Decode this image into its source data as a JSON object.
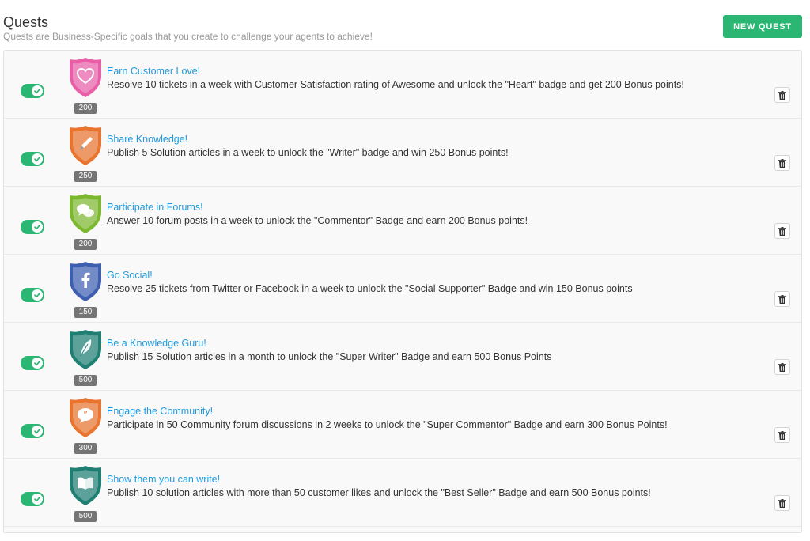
{
  "header": {
    "title": "Quests",
    "subtitle": "Quests are Business-Specific goals that you create to challenge your agents to achieve!",
    "new_quest_label": "NEW QUEST"
  },
  "colors": {
    "accent_green": "#2bb673",
    "link_blue": "#1e9be0"
  },
  "quests": [
    {
      "title": "Earn Customer Love!",
      "description": "Resolve 10 tickets in a week with Customer Satisfaction rating of Awesome and unlock the \"Heart\" badge and get 200 Bonus points!",
      "points": "200",
      "badge_icon": "heart-icon",
      "badge_color": "#e85fa8",
      "enabled": true
    },
    {
      "title": "Share Knowledge!",
      "description": "Publish 5 Solution articles in a week to unlock the \"Writer\" badge and win 250 Bonus points!",
      "points": "250",
      "badge_icon": "pen-icon",
      "badge_color": "#e8742f",
      "enabled": true
    },
    {
      "title": "Participate in Forums!",
      "description": "Answer 10 forum posts in a week to unlock the \"Commentor\" Badge and earn 200 Bonus points!",
      "points": "200",
      "badge_icon": "chat-bubbles-icon",
      "badge_color": "#7cb82f",
      "enabled": true
    },
    {
      "title": "Go Social!",
      "description": "Resolve 25 tickets from Twitter or Facebook in a week to unlock the \"Social Supporter\" Badge and win 150 Bonus points",
      "points": "150",
      "badge_icon": "facebook-icon",
      "badge_color": "#3e5fb0",
      "enabled": true
    },
    {
      "title": "Be a Knowledge Guru!",
      "description": "Publish 15 Solution articles in a month to unlock the \"Super Writer\" Badge and earn 500 Bonus Points",
      "points": "500",
      "badge_icon": "feather-icon",
      "badge_color": "#1f7f73",
      "enabled": true
    },
    {
      "title": "Engage the Community!",
      "description": "Participate in 50 Community forum discussions in 2 weeks to unlock the \"Super Commentor\" Badge and earn 300 Bonus Points!",
      "points": "300",
      "badge_icon": "quote-bubble-icon",
      "badge_color": "#e8742f",
      "enabled": true
    },
    {
      "title": "Show them you can write!",
      "description": "Publish 10 solution articles with more than 50 customer likes and unlock the \"Best Seller\" Badge and earn 500 Bonus points!",
      "points": "500",
      "badge_icon": "open-book-icon",
      "badge_color": "#1f7f73",
      "enabled": true
    }
  ]
}
